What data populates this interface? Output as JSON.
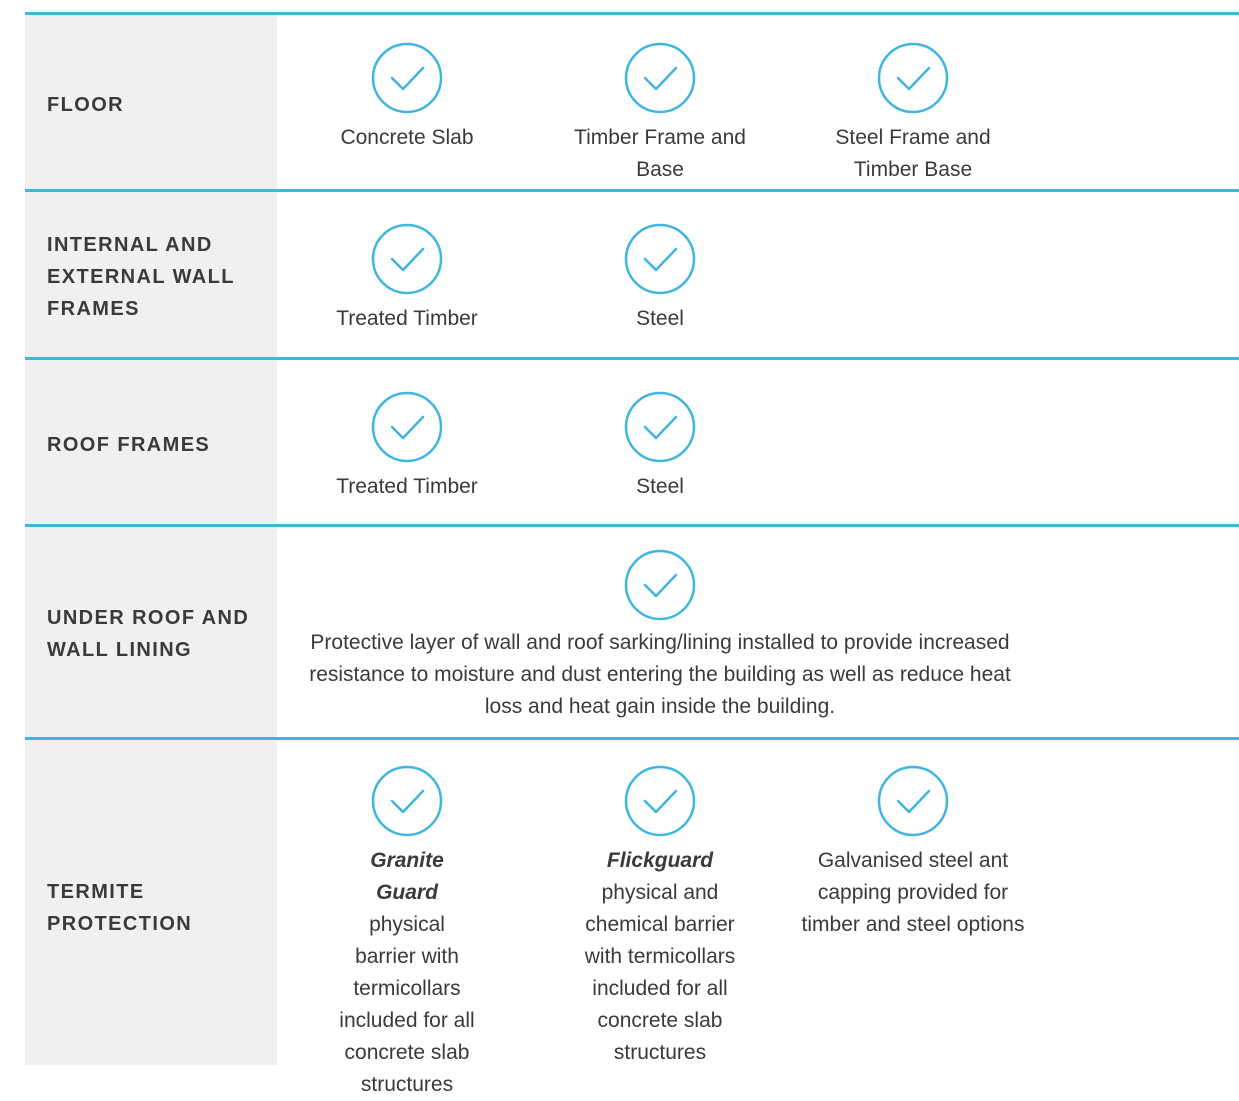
{
  "rows": [
    {
      "label": "FLOOR",
      "options": [
        {
          "text": "Concrete Slab"
        },
        {
          "text": "Timber Frame and Base"
        },
        {
          "text": "Steel Frame and Timber Base"
        }
      ]
    },
    {
      "label": "INTERNAL AND EXTERNAL WALL FRAMES",
      "options": [
        {
          "text": "Treated Timber"
        },
        {
          "text": "Steel"
        }
      ]
    },
    {
      "label": "ROOF FRAMES",
      "options": [
        {
          "text": "Treated Timber"
        },
        {
          "text": "Steel"
        }
      ]
    },
    {
      "label": "UNDER ROOF AND WALL LINING",
      "description": "Protective layer of wall and roof sarking/lining installed to provide increased resistance to moisture and dust entering the building as well as reduce heat loss and heat gain inside the building."
    },
    {
      "label": "TERMITE PROTECTION",
      "options": [
        {
          "emphasis": "Granite Guard",
          "text": "physical barrier with termicollars included for all concrete slab structures"
        },
        {
          "emphasis": "Flickguard",
          "text": "physical and chemical barrier with termicollars included for all concrete slab structures"
        },
        {
          "text": "Galvanised steel ant capping provided for timber and steel options"
        }
      ]
    }
  ],
  "icons": {
    "check": "check-circle-icon"
  },
  "colors": {
    "accent": "#3fb6e0",
    "label_bg": "#f0f0f0",
    "text": "#3a3a3a"
  }
}
